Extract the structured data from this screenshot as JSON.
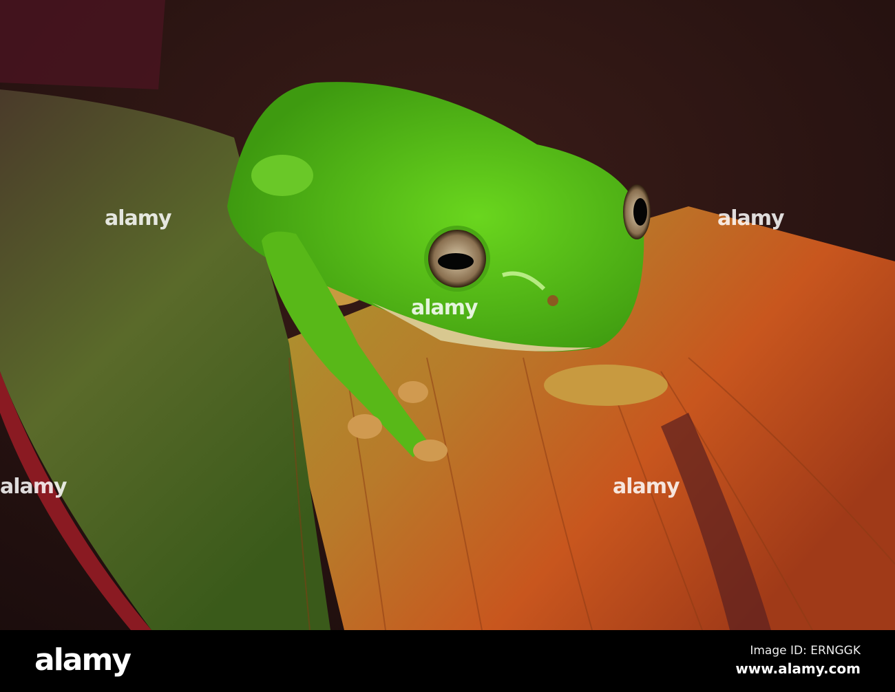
{
  "photo": {
    "colors": {
      "frog": "#5cc21c",
      "leaf_orange": "#c8581e",
      "leaf_green": "#7a8a2a",
      "background": "#2a1414"
    }
  },
  "watermark": {
    "text": "alamy"
  },
  "footer": {
    "logo": "alamy",
    "image_id": "Image ID: ERNGGK",
    "website": "www.alamy.com"
  }
}
